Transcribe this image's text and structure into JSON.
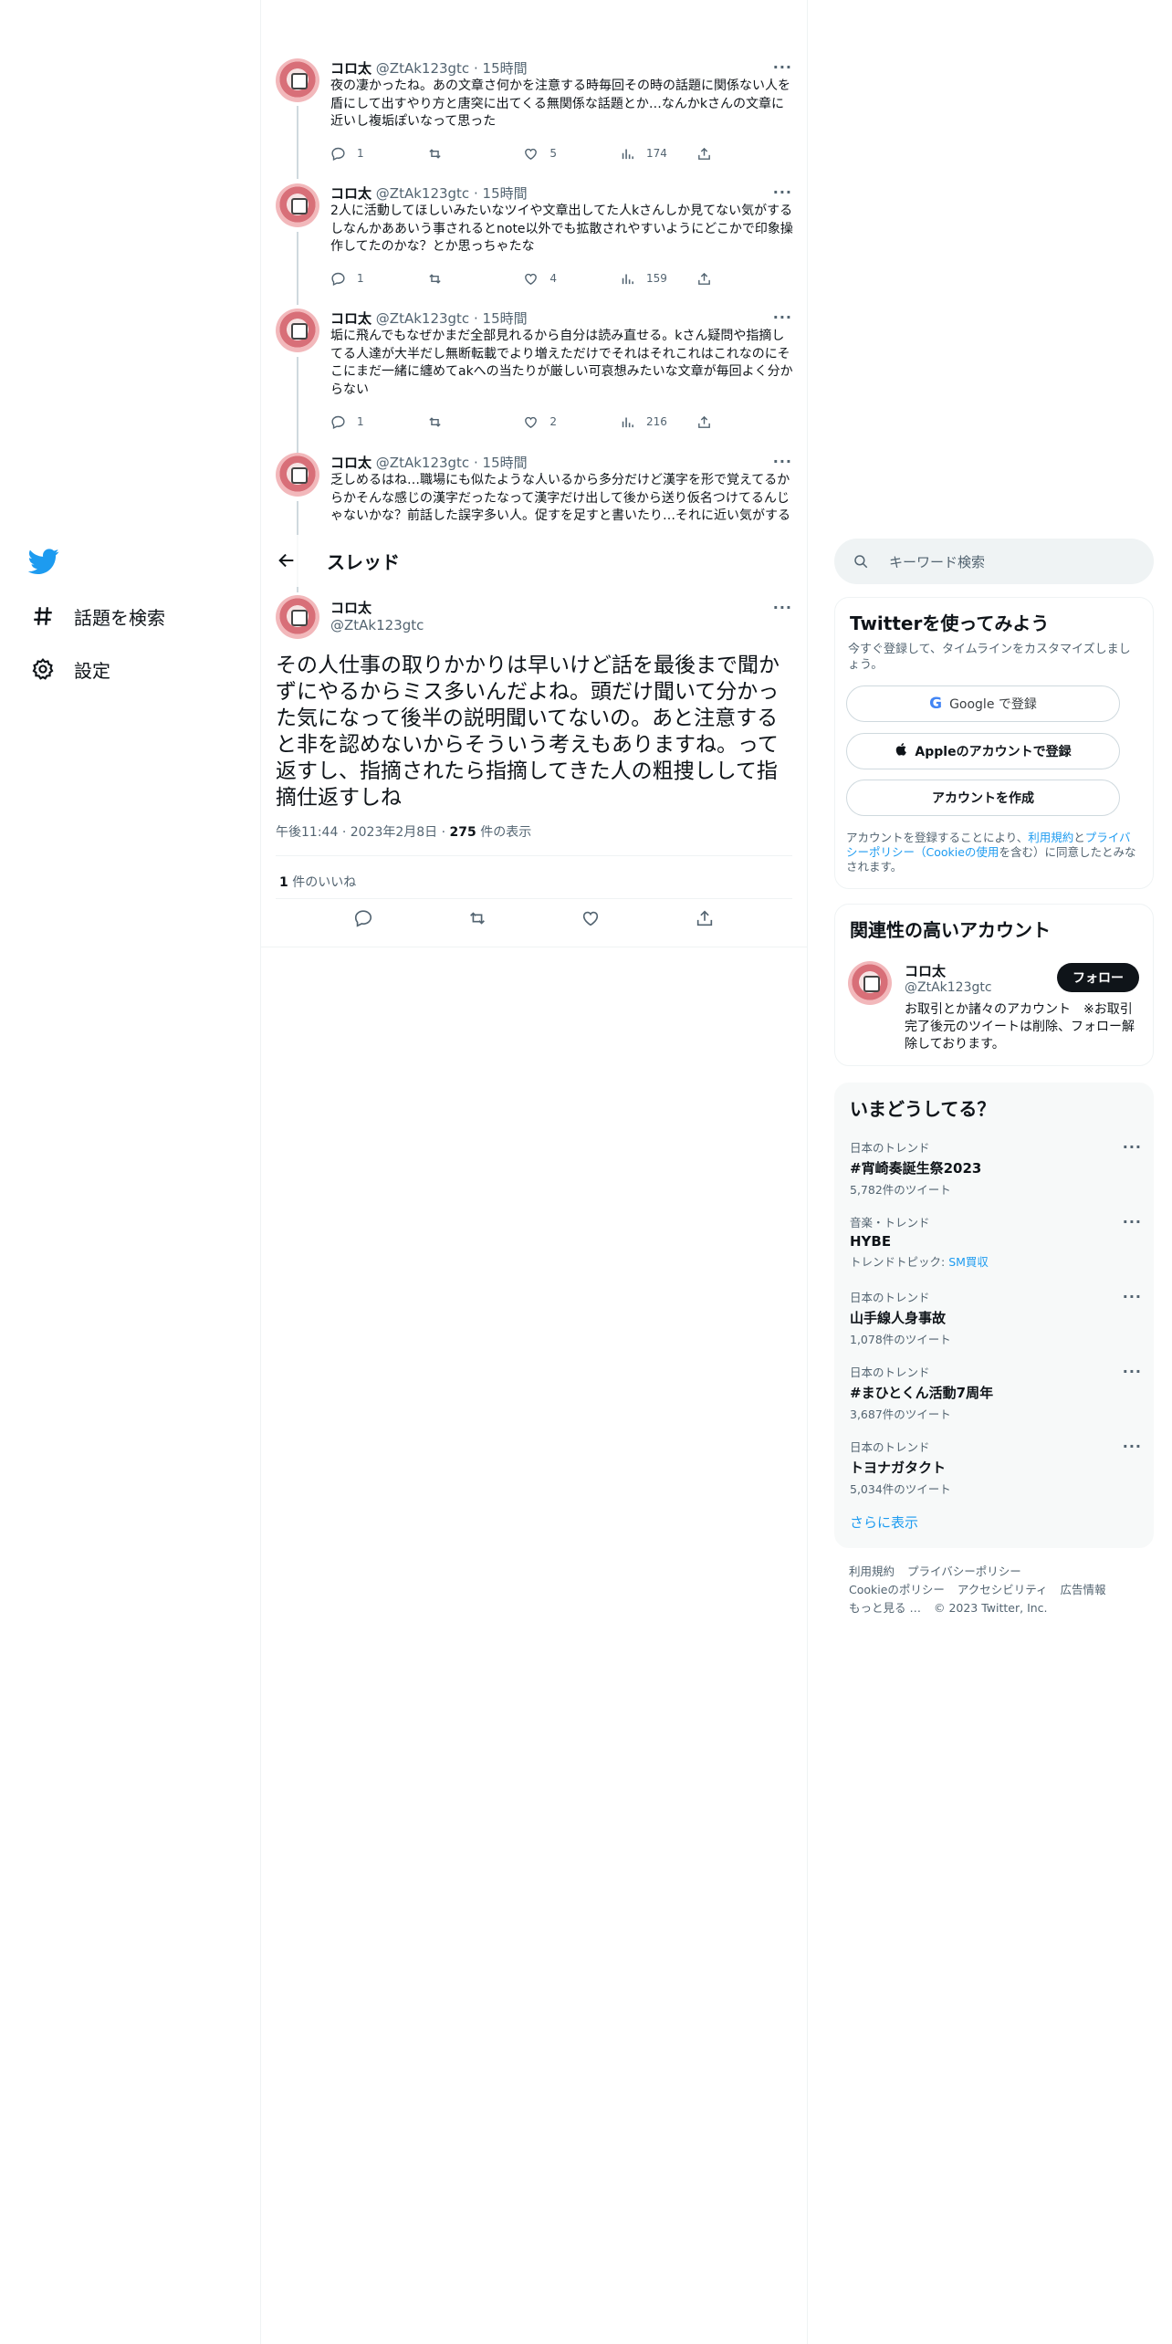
{
  "nav": {
    "explore_label": "話題を検索",
    "settings_label": "設定"
  },
  "header": {
    "title": "スレッド"
  },
  "thread_tweets": [
    {
      "name": "コロ太",
      "handle": "@ZtAk123gtc",
      "time": "15時間",
      "text": "夜の凄かったね。あの文章さ何かを注意する時毎回その時の話題に関係ない人を盾にして出すやり方と唐突に出てくる無関係な話題とか…なんかkさんの文章に近いし複垢ぽいなって思った",
      "replies": "1",
      "retweets": "",
      "likes": "5",
      "views": "174"
    },
    {
      "name": "コロ太",
      "handle": "@ZtAk123gtc",
      "time": "15時間",
      "text": "2人に活動してほしいみたいなツイや文章出してた人kさんしか見てない気がするしなんかああいう事されるとnote以外でも拡散されやすいようにどこかで印象操作してたのかな？とか思っちゃたな",
      "replies": "1",
      "retweets": "",
      "likes": "4",
      "views": "159"
    },
    {
      "name": "コロ太",
      "handle": "@ZtAk123gtc",
      "time": "15時間",
      "text": "垢に飛んでもなぜかまだ全部見れるから自分は読み直せる。kさん疑問や指摘してる人達が大半だし無断転載でより増えただけでそれはそれこれはこれなのにそこにまだ一緒に纏めてakへの当たりが厳しい可哀想みたいな文章が毎回よく分からない",
      "replies": "1",
      "retweets": "",
      "likes": "2",
      "views": "216"
    },
    {
      "name": "コロ太",
      "handle": "@ZtAk123gtc",
      "time": "15時間",
      "text": "乏しめるはね…職場にも似たような人いるから多分だけど漢字を形で覚えてるからかそんな感じの漢字だったなって漢字だけ出して後から送り仮名つけてるんじゃないかな？前話した誤字多い人。促すを足すと書いたり…それに近い気がする"
    }
  ],
  "focus_tweet": {
    "name": "コロ太",
    "handle": "@ZtAk123gtc",
    "text": "その人仕事の取りかかりは早いけど話を最後まで聞かずにやるからミス多いんだよね。頭だけ聞いて分かった気になって後半の説明聞いてないの。あと注意すると非を認めないからそういう考えもありますね。って返すし、指摘されたら指摘してきた人の粗捜しして指摘仕返すしね",
    "time": "午後11:44",
    "date": "2023年2月8日",
    "views_count": "275",
    "views_label": "件の表示",
    "likes_count": "1",
    "likes_label": "件のいいね"
  },
  "search": {
    "placeholder": "キーワード検索"
  },
  "signup": {
    "title": "Twitterを使ってみよう",
    "subtitle": "今すぐ登録して、タイムラインをカスタマイズしましょう。",
    "google_label": "Google で登録",
    "apple_label": "Appleのアカウントで登録",
    "create_label": "アカウントを作成",
    "legal_1": "アカウントを登録することにより、",
    "legal_terms": "利用規約",
    "legal_2": "と",
    "legal_privacy": "プライバシーポリシー（Cookieの使用",
    "legal_3": "を含む）に同意したとみなされます。"
  },
  "related": {
    "title": "関連性の高いアカウント",
    "name": "コロ太",
    "handle": "@ZtAk123gtc",
    "bio": "お取引とか諸々のアカウント　※お取引完了後元のツイートは削除、フォロー解除しております。",
    "follow_label": "フォロー"
  },
  "trends": {
    "title": "いまどうしてる？",
    "items": [
      {
        "context": "日本のトレンド",
        "name": "#宵崎奏誕生祭2023",
        "count": "5,782件のツイート"
      },
      {
        "context": "音楽・トレンド",
        "name": "HYBE",
        "count_prefix": "トレンドトピック: ",
        "count_link": "SM買収"
      },
      {
        "context": "日本のトレンド",
        "name": "山手線人身事故",
        "count": "1,078件のツイート"
      },
      {
        "context": "日本のトレンド",
        "name": "#まひとくん活動7周年",
        "count": "3,687件のツイート"
      },
      {
        "context": "日本のトレンド",
        "name": "トヨナガタクト",
        "count": "5,034件のツイート"
      }
    ],
    "show_more": "さらに表示"
  },
  "footer": {
    "terms": "利用規約",
    "privacy": "プライバシーポリシー",
    "cookie": "Cookieのポリシー",
    "accessibility": "アクセシビリティ",
    "ads": "広告情報",
    "more": "もっと見る …",
    "copyright": "© 2023 Twitter, Inc."
  },
  "colors": {
    "accent": "#1d9bf0",
    "text": "#0f1419",
    "muted": "#536471"
  }
}
